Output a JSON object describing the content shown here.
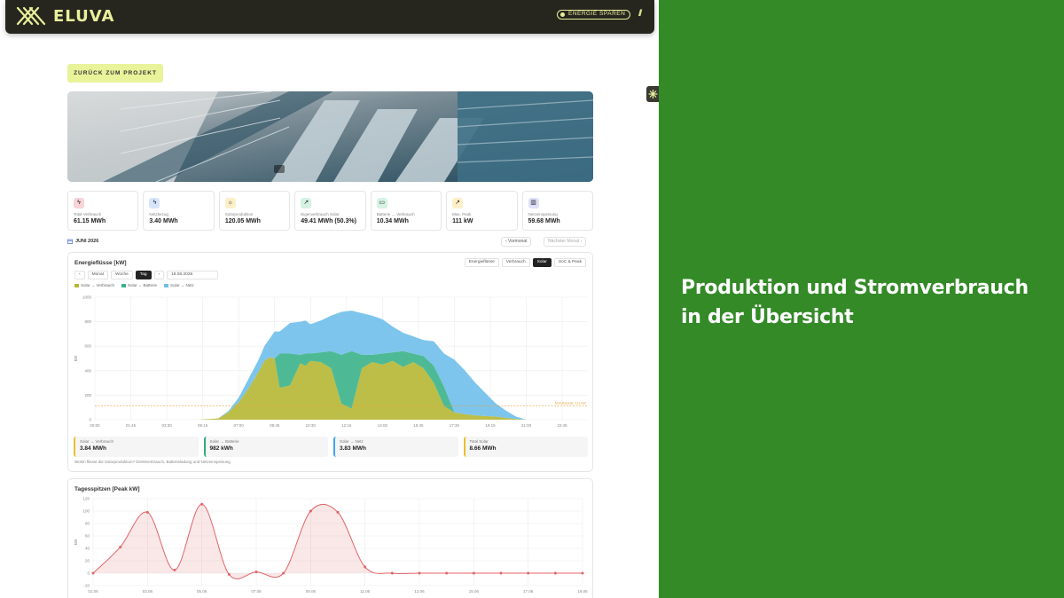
{
  "header": {
    "brand": "ELUVA",
    "energy_badge": "ENERGIE SPAREN",
    "slashes": "///"
  },
  "nav": {
    "back_label": "ZURÜCK ZUM PROJEKT"
  },
  "kpis": [
    {
      "label": "Total Verbrauch",
      "value": "61.15 MWh",
      "icon": "plug-icon",
      "color": "#f6d4d8"
    },
    {
      "label": "Netzbezug",
      "value": "3.40 MWh",
      "icon": "grid-icon",
      "color": "#d8e4fb"
    },
    {
      "label": "Solarproduktion",
      "value": "120.05 MWh",
      "icon": "sun-icon",
      "color": "#fcefc9"
    },
    {
      "label": "Eigenverbrauch Solar",
      "value": "49.41 MWh (50.3%)",
      "icon": "leaf-icon",
      "color": "#d5f2e2"
    },
    {
      "label": "Batterie → Verbrauch",
      "value": "10.34 MWh",
      "icon": "battery-icon",
      "color": "#d5f2e2"
    },
    {
      "label": "Max. Peak",
      "value": "111 kW",
      "icon": "peak-icon",
      "color": "#fcefc9"
    },
    {
      "label": "Netzeinspeisung",
      "value": "59.68 MWh",
      "icon": "chart-icon",
      "color": "#dfe1fb"
    }
  ],
  "month": {
    "label": "JUNI 2026",
    "prev": "‹ Vormonat",
    "next": "Nächster Monat ›"
  },
  "energy_card": {
    "title": "Energieflüsse [kW]",
    "view_tabs": [
      "Energieflüsse",
      "Verbrauch",
      "Solar",
      "SoC & Peak"
    ],
    "active_view": "Solar",
    "period_prev": "‹",
    "period_next": "›",
    "periods": [
      "Monat",
      "Woche",
      "Tag"
    ],
    "active_period": "Tag",
    "date": "18.06.2026",
    "peak_annotation": "Monatspeak: 111 kW",
    "note": "Wohin fliesst die Solarproduktion? Direktverbrauch, Batterieladung und Netzeinspeisung",
    "summaries": [
      {
        "label": "Solar → Verbrauch",
        "value": "3.84 MWh",
        "color": "#e8c12b"
      },
      {
        "label": "Solar → Batterie",
        "value": "982 kWh",
        "color": "#2eae7a"
      },
      {
        "label": "Solar → Netz",
        "value": "3.83 MWh",
        "color": "#3fa5e6"
      },
      {
        "label": "Total Solar",
        "value": "8.66 MWh",
        "color": "#e8c12b"
      }
    ]
  },
  "peaks_card": {
    "title": "Tagesspitzen [Peak kW]"
  },
  "promo": {
    "line1": "Produktion und Stromverbrauch",
    "line2": "in der Übersicht"
  },
  "chart_data": [
    {
      "type": "area",
      "title": "Energieflüsse [kW]",
      "ylabel": "kW",
      "ylim": [
        0,
        1000
      ],
      "yticks": [
        0,
        200,
        400,
        600,
        800,
        1000
      ],
      "xticks": [
        "00:00",
        "01:45",
        "03:30",
        "05:15",
        "07:00",
        "08:45",
        "10:30",
        "12:15",
        "14:00",
        "15:45",
        "17:30",
        "19:15",
        "21:00",
        "22:45"
      ],
      "x_hours": [
        0,
        1,
        2,
        3,
        4,
        5,
        6,
        6.5,
        7,
        7.5,
        8,
        8.25,
        8.5,
        8.75,
        9,
        9.5,
        10,
        10.25,
        10.5,
        11,
        11.5,
        12,
        12.5,
        13,
        13.5,
        14,
        14.5,
        15,
        15.5,
        16,
        16.5,
        17,
        17.5,
        18,
        18.5,
        19,
        19.5,
        20,
        20.5,
        21,
        22,
        23,
        24
      ],
      "series": [
        {
          "name": "Solar → Verbrauch",
          "color": "#b5b733",
          "values": [
            0,
            0,
            0,
            0,
            0,
            0,
            10,
            60,
            140,
            260,
            400,
            480,
            510,
            500,
            260,
            280,
            460,
            440,
            480,
            470,
            420,
            130,
            90,
            420,
            470,
            450,
            480,
            430,
            470,
            420,
            300,
            110,
            60,
            45,
            35,
            30,
            25,
            15,
            5,
            0,
            0,
            0,
            0
          ]
        },
        {
          "name": "Solar → Batterie",
          "color": "#3bb38a",
          "values": [
            0,
            0,
            0,
            0,
            0,
            0,
            0,
            0,
            0,
            0,
            0,
            0,
            0,
            0,
            280,
            260,
            70,
            100,
            60,
            80,
            140,
            400,
            470,
            110,
            60,
            90,
            70,
            130,
            70,
            100,
            140,
            160,
            0,
            0,
            0,
            0,
            0,
            0,
            0,
            0,
            0,
            0,
            0
          ]
        },
        {
          "name": "Solar → Netz",
          "color": "#6fbfea",
          "values": [
            0,
            0,
            0,
            0,
            0,
            0,
            0,
            10,
            40,
            80,
            100,
            120,
            150,
            220,
            180,
            250,
            270,
            270,
            240,
            260,
            290,
            350,
            330,
            340,
            320,
            280,
            210,
            150,
            140,
            130,
            200,
            270,
            430,
            360,
            270,
            190,
            110,
            60,
            20,
            0,
            0,
            0,
            0
          ]
        }
      ],
      "peak_line": 111
    },
    {
      "type": "line",
      "title": "Tagesspitzen [Peak kW]",
      "ylabel": "kW",
      "ylim": [
        -20,
        120
      ],
      "yticks": [
        -20,
        0,
        20,
        40,
        60,
        80,
        100,
        120
      ],
      "xticks": [
        "01.06",
        "03.06",
        "05.06",
        "07.06",
        "09.06",
        "11.06",
        "13.06",
        "15.06",
        "17.06",
        "19.06"
      ],
      "x_days": [
        1,
        2,
        3,
        4,
        5,
        6,
        7,
        8,
        9,
        10,
        11,
        12,
        13,
        14,
        15,
        16,
        17,
        18,
        19
      ],
      "values": [
        0,
        42,
        98,
        5,
        111,
        -2,
        2,
        0,
        100,
        98,
        10,
        0,
        0,
        0,
        0,
        0,
        0,
        0,
        0
      ],
      "color": "#e06468"
    }
  ]
}
